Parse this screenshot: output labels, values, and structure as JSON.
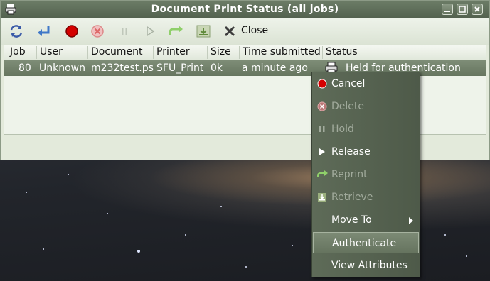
{
  "window": {
    "title": "Document Print Status (all jobs)"
  },
  "toolbar": {
    "close_label": "Close"
  },
  "list": {
    "columns": [
      "Job",
      "User",
      "Document",
      "Printer",
      "Size",
      "Time submitted",
      "Status"
    ],
    "rows": [
      {
        "job": "80",
        "user": "Unknown",
        "document": "m232test.ps",
        "printer": "SFU_Print",
        "size": "0k",
        "time_submitted": "a minute ago",
        "status": "Held for authentication"
      }
    ]
  },
  "context_menu": {
    "items": [
      {
        "label": "Cancel",
        "icon": "stop-red-icon",
        "enabled": true
      },
      {
        "label": "Delete",
        "icon": "delete-icon",
        "enabled": false
      },
      {
        "label": "Hold",
        "icon": "pause-icon",
        "enabled": false
      },
      {
        "label": "Release",
        "icon": "play-icon",
        "enabled": true
      },
      {
        "label": "Reprint",
        "icon": "redo-arrow-icon",
        "enabled": false
      },
      {
        "label": "Retrieve",
        "icon": "retrieve-icon",
        "enabled": false
      },
      {
        "label": "Move To",
        "icon": "",
        "enabled": true,
        "submenu": true
      },
      {
        "label": "Authenticate",
        "icon": "",
        "enabled": true,
        "highlighted": true
      },
      {
        "label": "View Attributes",
        "icon": "",
        "enabled": true
      }
    ]
  }
}
